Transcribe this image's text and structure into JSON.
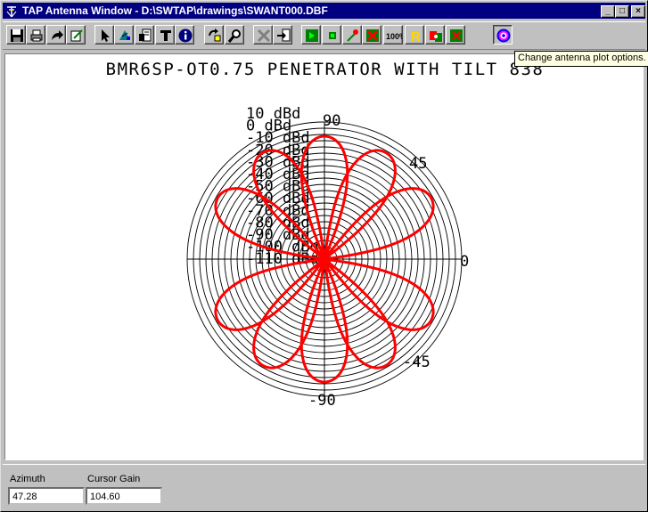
{
  "window": {
    "title": "TAP Antenna Window - D:\\SWTAP\\drawings\\SWANT000.DBF",
    "minimize_label": "_",
    "maximize_label": "□",
    "close_label": "×"
  },
  "toolbar": {
    "buttons": [
      {
        "name": "save-button",
        "icon": "floppy-disk-icon"
      },
      {
        "name": "print-button",
        "icon": "printer-icon"
      },
      {
        "name": "export-button",
        "icon": "arrow-right-icon"
      },
      {
        "name": "edit-button",
        "icon": "pencil-icon"
      },
      {
        "name": "select-button",
        "icon": "cursor-arrow-icon"
      },
      {
        "name": "pattern-button",
        "icon": "antenna-pattern-icon"
      },
      {
        "name": "properties-button",
        "icon": "document-edit-icon"
      },
      {
        "name": "text-button",
        "icon": "text-t-icon"
      },
      {
        "name": "info-button",
        "icon": "info-icon"
      },
      {
        "name": "rotate-button",
        "icon": "rotate-icon"
      },
      {
        "name": "zoom-button",
        "icon": "magnifier-icon"
      },
      {
        "name": "delete-button",
        "icon": "x-delete-icon"
      },
      {
        "name": "import-button",
        "icon": "import-icon"
      },
      {
        "name": "green-tool-1-button",
        "icon": "green-square-icon"
      },
      {
        "name": "green-tool-2-button",
        "icon": "green-square-small-icon"
      },
      {
        "name": "probe-button",
        "icon": "probe-icon"
      },
      {
        "name": "red-tool-button",
        "icon": "red-square-icon"
      },
      {
        "name": "percent-button",
        "icon": "percent-icon",
        "label": "100%"
      },
      {
        "name": "r-button",
        "icon": "r-icon",
        "label": "R"
      },
      {
        "name": "compare-button",
        "icon": "compare-icon"
      },
      {
        "name": "green-tool-3-button",
        "icon": "green-square-red-icon"
      },
      {
        "name": "plot-options-button",
        "icon": "target-circle-icon"
      }
    ],
    "tooltip": "Change antenna plot options."
  },
  "plot": {
    "title": "BMR6SP-OT0.75 PENETRATOR WITH TILT 838",
    "angle_labels": {
      "top": "90",
      "upper_right": "45",
      "right": "0",
      "lower_right": "-45",
      "bottom": "-90"
    },
    "ring_labels": [
      "10 dBd",
      "0 dBd",
      "-10 dBd",
      "-20 dBd",
      "-30 dBd",
      "-40 dBd",
      "-50 dBd",
      "-60 dBd",
      "-70 dBd",
      "-80 dBd",
      "-90 dBd",
      "-100 dBd",
      "-110 dBd"
    ],
    "pattern_color": "#ff0000",
    "lobes_deg": [
      -150,
      -120,
      -90,
      -60,
      -30,
      30,
      60,
      90,
      120,
      150
    ]
  },
  "status": {
    "azimuth_label": "Azimuth",
    "azimuth_value": "47.28",
    "cursor_gain_label": "Cursor Gain",
    "cursor_gain_value": "104.60"
  }
}
